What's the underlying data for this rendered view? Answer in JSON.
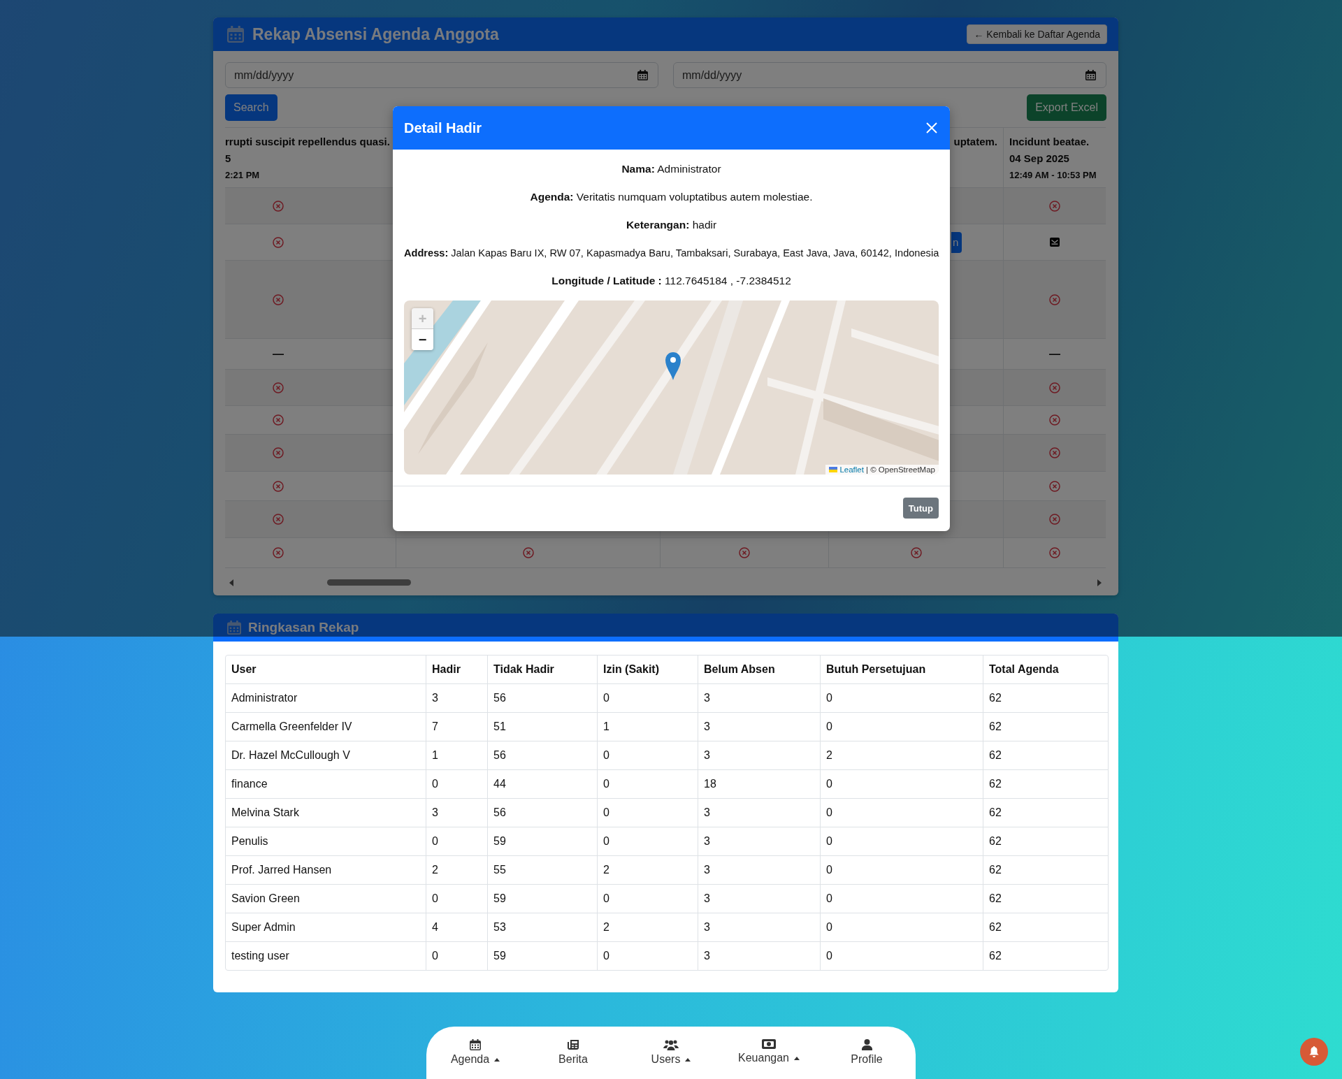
{
  "rekap": {
    "title": "Rekap Absensi Agenda Anggota",
    "back_button": "← Kembali ke Daftar Agenda",
    "date_fields": [
      {
        "placeholder": "mm/dd/yyyy"
      },
      {
        "placeholder": "mm/dd/yyyy"
      }
    ],
    "search_button": "Search",
    "export_button": "Export Excel",
    "table": {
      "columns": [
        {
          "title": "rrupti suscipit repellendus quasi.",
          "date": "5",
          "time": "2:21 PM"
        },
        {},
        {},
        {
          "title": "uptatem."
        },
        {
          "title": "Incidunt beatae.",
          "date": "04 Sep 2025",
          "time": "12:49 AM - 10:53 PM"
        }
      ],
      "rows": [
        {
          "cells": [
            {
              "kind": "absent"
            },
            {
              "kind": "blank"
            },
            {
              "kind": "blank"
            },
            {
              "kind": "blank"
            },
            {
              "kind": "absent"
            }
          ]
        },
        {
          "cells": [
            {
              "kind": "absent"
            },
            {
              "kind": "blank"
            },
            {
              "kind": "blank"
            },
            {
              "kind": "button",
              "label": "n"
            },
            {
              "kind": "mail"
            }
          ]
        },
        {
          "cells": [
            {
              "kind": "absent"
            },
            {
              "kind": "blank"
            },
            {
              "kind": "blank"
            },
            {
              "kind": "blank"
            },
            {
              "kind": "absent"
            }
          ]
        },
        {
          "cells": [
            {
              "kind": "text",
              "text": "—"
            },
            {
              "kind": "blank"
            },
            {
              "kind": "blank"
            },
            {
              "kind": "blank"
            },
            {
              "kind": "text",
              "text": "—"
            }
          ]
        },
        {
          "cells": [
            {
              "kind": "absent"
            },
            {
              "kind": "blank"
            },
            {
              "kind": "blank"
            },
            {
              "kind": "blank"
            },
            {
              "kind": "absent"
            }
          ]
        },
        {
          "cells": [
            {
              "kind": "absent"
            },
            {
              "kind": "blank"
            },
            {
              "kind": "blank"
            },
            {
              "kind": "blank"
            },
            {
              "kind": "absent"
            }
          ]
        },
        {
          "cells": [
            {
              "kind": "absent"
            },
            {
              "kind": "blank"
            },
            {
              "kind": "blank"
            },
            {
              "kind": "blank"
            },
            {
              "kind": "absent"
            }
          ]
        },
        {
          "cells": [
            {
              "kind": "absent"
            },
            {
              "kind": "blank"
            },
            {
              "kind": "blank"
            },
            {
              "kind": "blank"
            },
            {
              "kind": "absent"
            }
          ]
        },
        {
          "cells": [
            {
              "kind": "absent"
            },
            {
              "kind": "blank"
            },
            {
              "kind": "blank"
            },
            {
              "kind": "blank"
            },
            {
              "kind": "absent"
            }
          ]
        },
        {
          "cells": [
            {
              "kind": "absent"
            },
            {
              "kind": "absent"
            },
            {
              "kind": "absent"
            },
            {
              "kind": "absent"
            },
            {
              "kind": "absent"
            }
          ]
        }
      ]
    }
  },
  "modal": {
    "title": "Detail Hadir",
    "lines": [
      "**Nama:** Administrator",
      "**Agenda:** Veritatis numquam voluptatibus autem molestiae.",
      "**Keterangan:** hadir",
      "**Address:** Jalan Kapas Baru IX, RW 07, Kapasmadya Baru, Tambaksari, Surabaya, East Java, Java, 60142, Indonesia",
      "**Longitude / Latitude :** 112.7645184 , -7.2384512"
    ],
    "map": {
      "kind": "picture",
      "zoom_controls": [
        {
          "label": "+",
          "disabled": true
        },
        {
          "label": "−",
          "disabled": false
        }
      ],
      "attribution_link": "Leaflet",
      "attribution_text": "| © OpenStreetMap"
    },
    "close_button": "Tutup"
  },
  "ringkasan": {
    "title": "Ringkasan Rekap",
    "columns": [
      "User",
      "Hadir",
      "Tidak Hadir",
      "Izin (Sakit)",
      "Belum Absen",
      "Butuh Persetujuan",
      "Total Agenda"
    ],
    "rows": [
      [
        "Administrator",
        "3",
        "56",
        "0",
        "3",
        "0",
        "62"
      ],
      [
        "Carmella Greenfelder IV",
        "7",
        "51",
        "1",
        "3",
        "0",
        "62"
      ],
      [
        "Dr. Hazel McCullough V",
        "1",
        "56",
        "0",
        "3",
        "2",
        "62"
      ],
      [
        "finance",
        "0",
        "44",
        "0",
        "18",
        "0",
        "62"
      ],
      [
        "Melvina Stark",
        "3",
        "56",
        "0",
        "3",
        "0",
        "62"
      ],
      [
        "Penulis",
        "0",
        "59",
        "0",
        "3",
        "0",
        "62"
      ],
      [
        "Prof. Jarred Hansen",
        "2",
        "55",
        "2",
        "3",
        "0",
        "62"
      ],
      [
        "Savion Green",
        "0",
        "59",
        "0",
        "3",
        "0",
        "62"
      ],
      [
        "Super Admin",
        "4",
        "53",
        "2",
        "3",
        "0",
        "62"
      ],
      [
        "testing user",
        "0",
        "59",
        "0",
        "3",
        "0",
        "62"
      ]
    ]
  },
  "nav": {
    "items": [
      {
        "label": "Agenda",
        "dropdown": true
      },
      {
        "label": "Berita",
        "dropdown": false
      },
      {
        "label": "Users",
        "dropdown": true
      },
      {
        "label": "Keuangan",
        "dropdown": true
      },
      {
        "label": "Profile",
        "dropdown": false
      }
    ]
  }
}
